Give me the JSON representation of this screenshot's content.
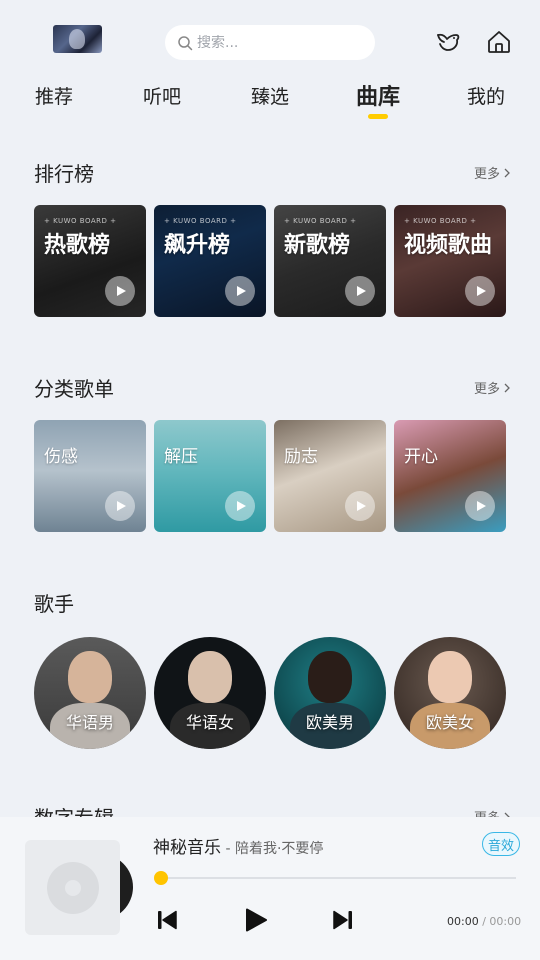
{
  "search": {
    "placeholder": "搜索..."
  },
  "tabs": [
    {
      "label": "推荐"
    },
    {
      "label": "听吧"
    },
    {
      "label": "臻选"
    },
    {
      "label": "曲库",
      "active": true
    },
    {
      "label": "我的"
    }
  ],
  "more_label": "更多",
  "sections": {
    "charts": {
      "title": "排行榜",
      "items": [
        {
          "tag": "+ KUWO BOARD +",
          "label": "热歌榜"
        },
        {
          "tag": "+ KUWO BOARD +",
          "label": "飙升榜"
        },
        {
          "tag": "+ KUWO BOARD +",
          "label": "新歌榜"
        },
        {
          "tag": "+ KUWO BOARD +",
          "label": "视频歌曲"
        }
      ]
    },
    "categories": {
      "title": "分类歌单",
      "items": [
        {
          "label": "伤感"
        },
        {
          "label": "解压"
        },
        {
          "label": "励志"
        },
        {
          "label": "开心"
        }
      ]
    },
    "singers": {
      "title": "歌手",
      "items": [
        {
          "label": "华语男"
        },
        {
          "label": "华语女"
        },
        {
          "label": "欧美男"
        },
        {
          "label": "欧美女"
        }
      ]
    },
    "albums": {
      "title": "数字专辑"
    }
  },
  "player": {
    "title": "神秘音乐",
    "subtitle": " - 陪着我·不要停",
    "effect_label": "音效",
    "current_time": "00:00",
    "separator": " / ",
    "duration": "00:00",
    "progress": 0
  },
  "colors": {
    "accent": "#ffcc00",
    "effect": "#39b7e6"
  }
}
